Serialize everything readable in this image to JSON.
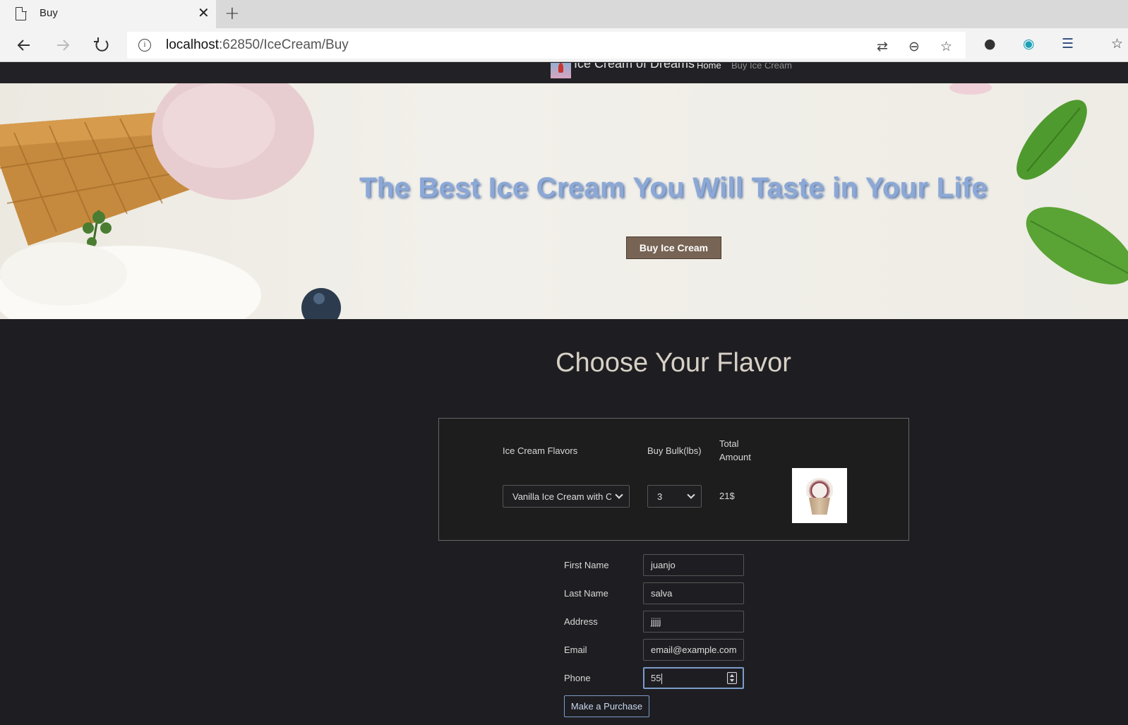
{
  "browser": {
    "tab_title": "Buy",
    "url_host": "localhost",
    "url_path": ":62850/IceCream/Buy"
  },
  "site": {
    "brand": "Ice Cream of Dreams",
    "nav": {
      "home": "Home",
      "buy": "Buy Ice Cream"
    }
  },
  "hero": {
    "title": "The Best Ice Cream You Will Taste in Your Life",
    "button": "Buy Ice Cream"
  },
  "main": {
    "section_title": "Choose Your Flavor",
    "order": {
      "flavors_label": "Ice Cream Flavors",
      "bulk_label": "Buy Bulk(lbs)",
      "total_label_line1": "Total",
      "total_label_line2": "Amount",
      "flavor_selected": "Vanilla Ice Cream with C",
      "bulk_selected": "3",
      "total_value": "21$"
    },
    "form": {
      "first_name_label": "First Name",
      "first_name_value": "juanjo",
      "last_name_label": "Last Name",
      "last_name_value": "salva",
      "address_label": "Address",
      "address_value": "jjjjj",
      "email_label": "Email",
      "email_value": "email@example.com",
      "phone_label": "Phone",
      "phone_value": "55",
      "submit": "Make a Purchase"
    }
  },
  "colors": {
    "page_bg": "#1e1e22",
    "hero_title": "#8ba8d6",
    "hero_button": "#776454",
    "accent_border": "#7d9cc9"
  }
}
